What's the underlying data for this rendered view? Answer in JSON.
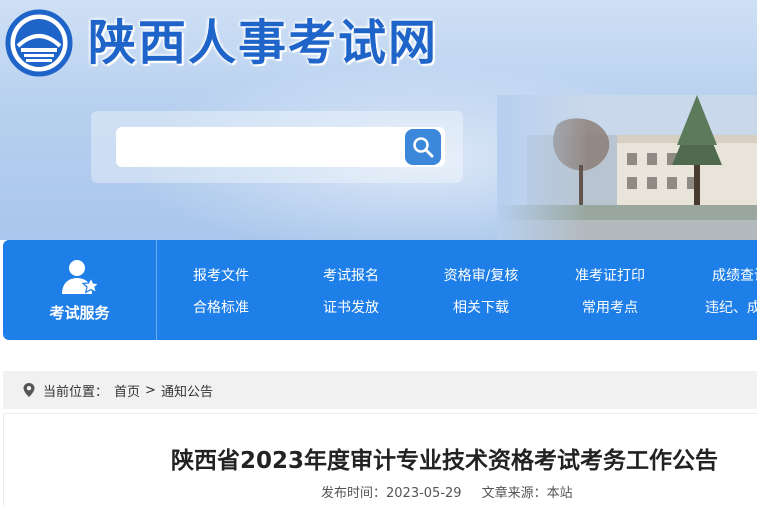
{
  "header": {
    "site_title": "陕西人事考试网",
    "search": {
      "placeholder": "",
      "button_icon": "search-icon"
    },
    "logo_icon": "emblem-icon"
  },
  "nav": {
    "service_label": "考试服务",
    "service_icon": "user-star-icon",
    "row1": [
      "报考文件",
      "考试报名",
      "资格审/复核",
      "准考证打印",
      "成绩查询"
    ],
    "row2": [
      "合格标准",
      "证书发放",
      "相关下载",
      "常用考点",
      "违纪、成绩"
    ]
  },
  "breadcrumb": {
    "prefix": "当前位置：",
    "home": "首页",
    "separator": ">",
    "current": "通知公告",
    "icon": "location-pin-icon"
  },
  "article": {
    "title": "陕西省2023年度审计专业技术资格考试考务工作公告",
    "published_label": "发布时间：2023-05-29",
    "source_label": "文章来源：本站"
  },
  "colors": {
    "brand_blue": "#1f7fe8",
    "title_blue": "#1f64c8",
    "search_button": "#3b87d9"
  }
}
